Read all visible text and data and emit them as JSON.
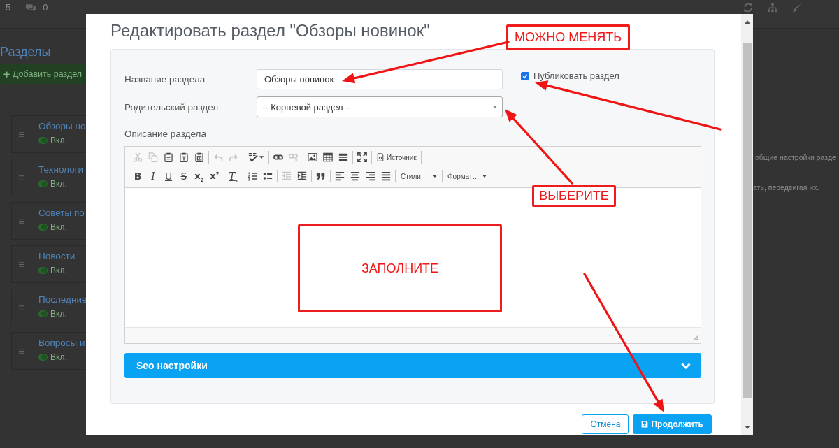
{
  "background": {
    "top_bar": {
      "notifications": "5",
      "messages": "0"
    },
    "heading": "Разделы",
    "add_button": "Добавить раздел",
    "sections": [
      {
        "title": "Обзоры но",
        "status": "Вкл.",
        "enabled": true
      },
      {
        "title": "Технологи",
        "status": "Вкл.",
        "enabled": true
      },
      {
        "title": "Советы по",
        "status": "Вкл.",
        "enabled": true
      },
      {
        "title": "Новости",
        "status": "Вкл.",
        "enabled": true
      },
      {
        "title": "Последние",
        "status": "Вкл.",
        "enabled": true
      },
      {
        "title": "Вопросы и",
        "status": "Вкл.",
        "enabled": true
      }
    ],
    "hint_lines": [
      "общие настройки разде",
      "ать, передвигая их."
    ]
  },
  "dialog": {
    "title": "Редактировать раздел \"Обзоры новинок\"",
    "name_field": {
      "label": "Название раздела",
      "value": "Обзоры новинок"
    },
    "publish": {
      "label": "Публиковать раздел",
      "checked": true
    },
    "parent_field": {
      "label": "Родительский раздел",
      "value": "-- Корневой раздел --"
    },
    "description": {
      "label": "Описание раздела",
      "toolbar": {
        "rows": [
          {
            "groups": [
              {
                "items": [
                  {
                    "kind": "icon",
                    "disabled": true
                  },
                  {
                    "kind": "icon",
                    "disabled": true
                  },
                  {
                    "kind": "icon",
                    "disabled": false
                  },
                  {
                    "kind": "icon",
                    "disabled": false
                  },
                  {
                    "kind": "icon",
                    "disabled": false
                  }
                ]
              },
              {
                "items": [
                  {
                    "kind": "icon",
                    "disabled": true
                  },
                  {
                    "kind": "icon",
                    "disabled": true
                  }
                ]
              },
              {
                "items": [
                  {
                    "kind": "icon-menu",
                    "disabled": false
                  }
                ]
              },
              {
                "items": [
                  {
                    "kind": "icon",
                    "disabled": false
                  },
                  {
                    "kind": "icon",
                    "disabled": true
                  }
                ]
              },
              {
                "items": [
                  {
                    "kind": "icon",
                    "disabled": false
                  },
                  {
                    "kind": "icon",
                    "disabled": false
                  },
                  {
                    "kind": "icon",
                    "disabled": false
                  }
                ]
              },
              {
                "items": [
                  {
                    "kind": "icon",
                    "disabled": false
                  }
                ]
              },
              {
                "items": [
                  {
                    "kind": "icon-text",
                    "label": "Источник",
                    "disabled": false
                  }
                ]
              }
            ]
          },
          {
            "groups": [
              {
                "items": [
                  {
                    "kind": "glyph",
                    "label": "B",
                    "disabled": false
                  },
                  {
                    "kind": "glyph",
                    "label": "I",
                    "disabled": false
                  },
                  {
                    "kind": "glyph",
                    "label": "U",
                    "disabled": false
                  },
                  {
                    "kind": "glyph",
                    "label": "S",
                    "disabled": false
                  },
                  {
                    "kind": "glyph",
                    "label": "x$_{2}$",
                    "disabled": false
                  },
                  {
                    "kind": "glyph",
                    "label": "x$^{2}$",
                    "disabled": false
                  }
                ]
              },
              {
                "items": [
                  {
                    "kind": "glyph",
                    "label": "T$_{x}$",
                    "disabled": false
                  }
                ]
              },
              {
                "items": [
                  {
                    "kind": "icon",
                    "disabled": false
                  },
                  {
                    "kind": "icon",
                    "disabled": false
                  }
                ]
              },
              {
                "items": [
                  {
                    "kind": "icon",
                    "disabled": true
                  },
                  {
                    "kind": "icon",
                    "disabled": false
                  }
                ]
              },
              {
                "items": [
                  {
                    "kind": "icon",
                    "disabled": false
                  }
                ]
              },
              {
                "items": [
                  {
                    "kind": "icon",
                    "disabled": false
                  },
                  {
                    "kind": "icon",
                    "disabled": false
                  },
                  {
                    "kind": "icon",
                    "disabled": false
                  },
                  {
                    "kind": "icon",
                    "disabled": false
                  }
                ]
              },
              {
                "items": [
                  {
                    "kind": "dropdown",
                    "label": "Стили",
                    "disabled": false
                  }
                ]
              },
              {
                "items": [
                  {
                    "kind": "dropdown",
                    "label": "Формат…",
                    "disabled": false
                  }
                ]
              }
            ]
          }
        ]
      }
    },
    "seo_section": {
      "label": "Seo настройки",
      "expanded": false
    },
    "buttons": [
      {
        "label": "Отмена",
        "kind": "cancel"
      },
      {
        "label": "Продолжить",
        "kind": "save"
      }
    ]
  },
  "annotations": [
    {
      "text": "МОЖНО МЕНЯТЬ"
    },
    {
      "text": "ВЫБЕРИТЕ"
    },
    {
      "text": "ЗАПОЛНИТЕ"
    }
  ]
}
